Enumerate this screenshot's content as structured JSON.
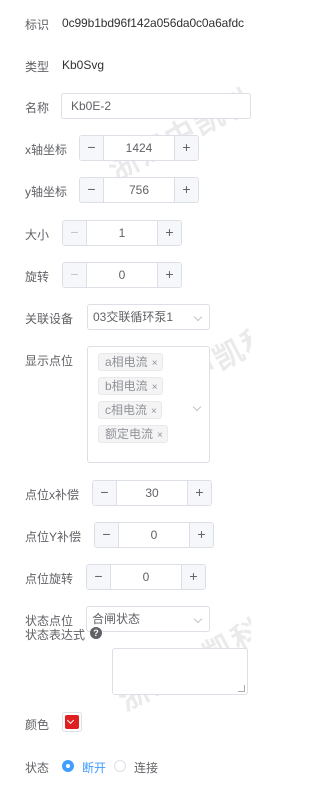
{
  "watermark": {
    "text": "浙江中凯科"
  },
  "fields": {
    "id": {
      "label": "标识",
      "value": "0c99b1bd96f142a056da0c0a6afdc"
    },
    "type": {
      "label": "类型",
      "value": "Kb0Svg"
    },
    "name": {
      "label": "名称",
      "value": "Kb0E-2"
    },
    "x": {
      "label": "x轴坐标",
      "value": "1424"
    },
    "y": {
      "label": "y轴坐标",
      "value": "756"
    },
    "size": {
      "label": "大小",
      "value": "1"
    },
    "rotate": {
      "label": "旋转",
      "value": "0"
    },
    "device": {
      "label": "关联设备",
      "value": "03交联循环泵1"
    },
    "points": {
      "label": "显示点位",
      "tags": [
        "a相电流",
        "b相电流",
        "c相电流",
        "额定电流"
      ]
    },
    "point_x_offset": {
      "label": "点位x补偿",
      "value": "30"
    },
    "point_y_offset": {
      "label": "点位Y补偿",
      "value": "0"
    },
    "point_rotate": {
      "label": "点位旋转",
      "value": "0"
    },
    "status_point": {
      "label": "状态点位",
      "value": "合闸状态"
    },
    "status_expr": {
      "label": "状态表达式",
      "value": ""
    },
    "color": {
      "label": "颜色",
      "value": "#e02020"
    },
    "status": {
      "label": "状态",
      "options": [
        "断开",
        "连接"
      ],
      "selected": "断开"
    }
  },
  "icons": {
    "minus": "−",
    "plus": "+",
    "help": "?",
    "tag_close": "×"
  }
}
